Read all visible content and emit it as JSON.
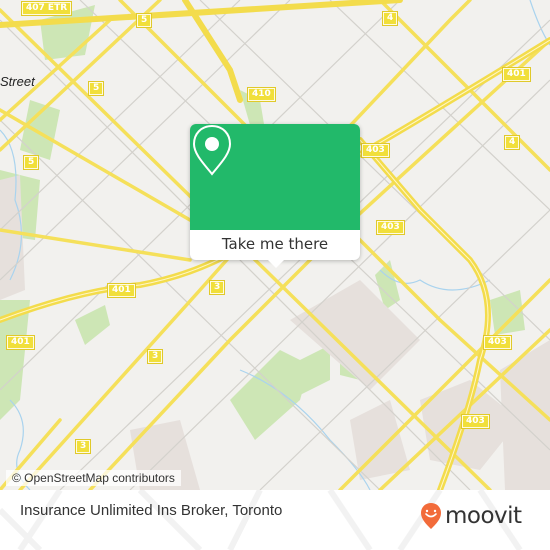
{
  "map": {
    "place_label": "Street",
    "shields": [
      {
        "id": "407etr",
        "label": "407 ETR"
      },
      {
        "id": "5a",
        "label": "5"
      },
      {
        "id": "5b",
        "label": "5"
      },
      {
        "id": "5c",
        "label": "5"
      },
      {
        "id": "4a",
        "label": "4"
      },
      {
        "id": "4b",
        "label": "4"
      },
      {
        "id": "401a",
        "label": "401"
      },
      {
        "id": "401b",
        "label": "401"
      },
      {
        "id": "401c",
        "label": "401"
      },
      {
        "id": "410",
        "label": "410"
      },
      {
        "id": "403a",
        "label": "403"
      },
      {
        "id": "403b",
        "label": "403"
      },
      {
        "id": "403c",
        "label": "403"
      },
      {
        "id": "403d",
        "label": "403"
      },
      {
        "id": "3a",
        "label": "3"
      },
      {
        "id": "3b",
        "label": "3"
      },
      {
        "id": "3c",
        "label": "3"
      }
    ],
    "attribution": "© OpenStreetMap contributors"
  },
  "popup": {
    "icon": "map-pin-icon",
    "button_label": "Take me there",
    "accent_color": "#22b96a"
  },
  "footer": {
    "title": "Insurance Unlimited Ins Broker, Toronto",
    "brand": "moovit",
    "brand_color": "#f26b3a"
  }
}
